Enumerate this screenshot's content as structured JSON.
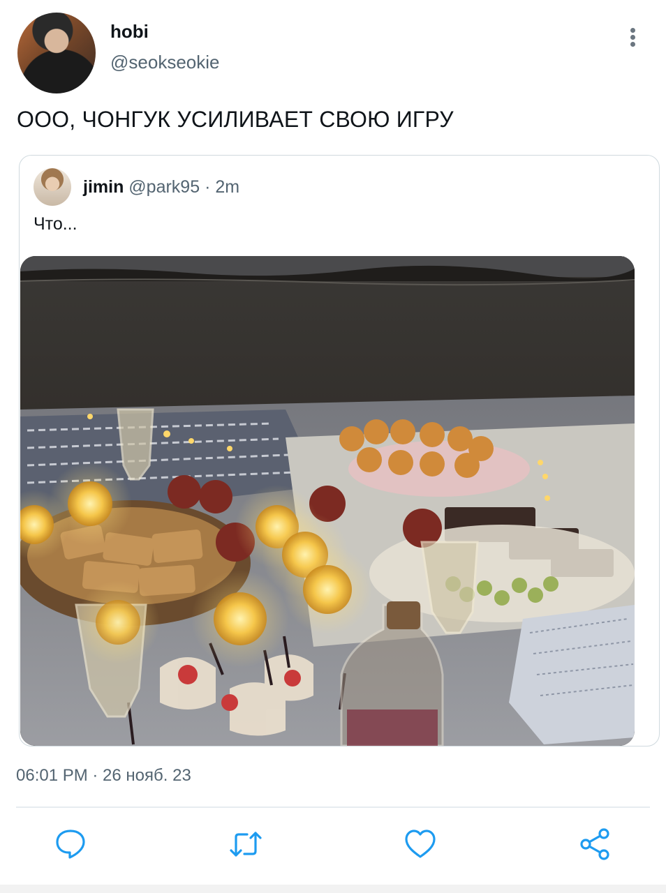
{
  "author": {
    "display_name": "hobi",
    "handle": "@seokseokie"
  },
  "tweet": {
    "text": "ООО, ЧОНГУК УСИЛИВАЕТ СВОЮ ИГРУ",
    "timestamp": "06:01 PM · 26 нояб. 23"
  },
  "quote": {
    "display_name": "jimin",
    "handle": "@park95",
    "separator": "·",
    "time": "2m",
    "text": "Что..."
  },
  "icons": {
    "more": "more-vertical-icon",
    "reply": "reply-icon",
    "retweet": "retweet-icon",
    "like": "heart-icon",
    "share": "share-icon"
  },
  "colors": {
    "text": "#0f1419",
    "secondary": "#536471",
    "border": "#cfd9de",
    "icon": "#1d9bf0"
  }
}
